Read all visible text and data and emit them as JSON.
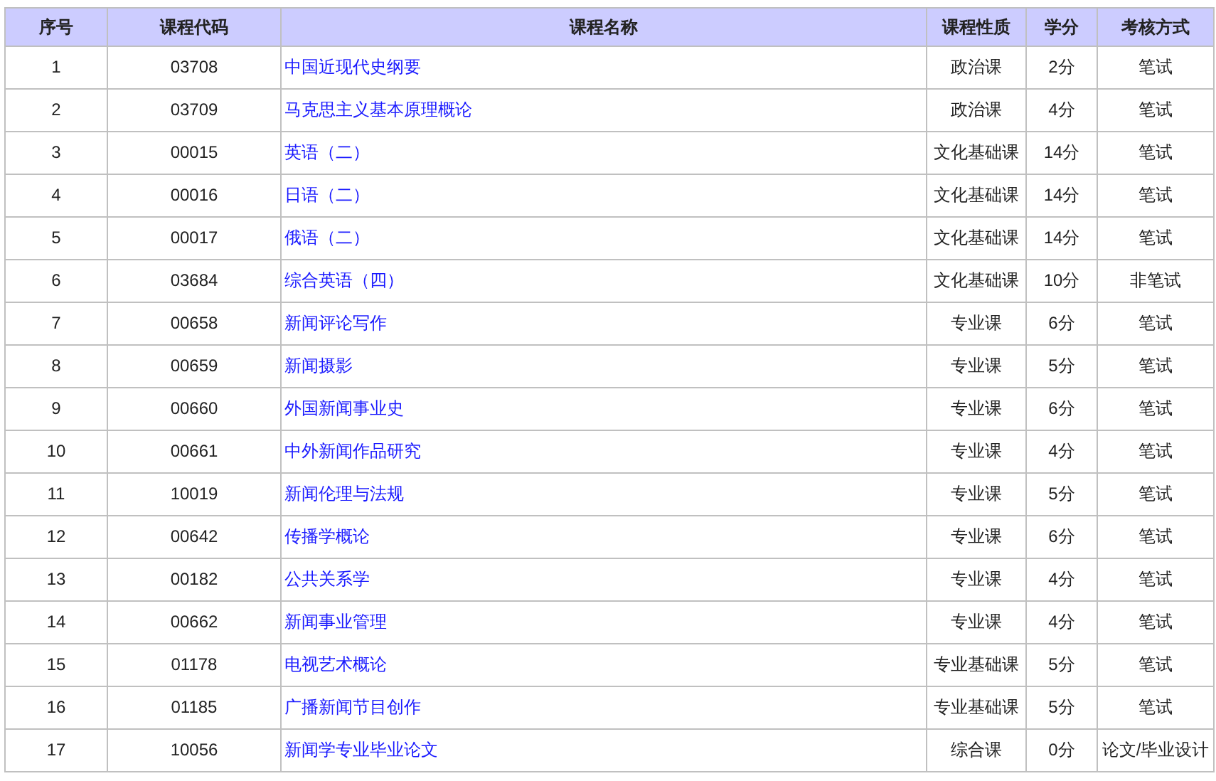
{
  "table": {
    "columns": [
      "序号",
      "课程代码",
      "课程名称",
      "课程性质",
      "学分",
      "考核方式"
    ],
    "rows": [
      [
        "1",
        "03708",
        "中国近现代史纲要",
        "政治课",
        "2分",
        "笔试"
      ],
      [
        "2",
        "03709",
        "马克思主义基本原理概论",
        "政治课",
        "4分",
        "笔试"
      ],
      [
        "3",
        "00015",
        "英语（二）",
        "文化基础课",
        "14分",
        "笔试"
      ],
      [
        "4",
        "00016",
        "日语（二）",
        "文化基础课",
        "14分",
        "笔试"
      ],
      [
        "5",
        "00017",
        "俄语（二）",
        "文化基础课",
        "14分",
        "笔试"
      ],
      [
        "6",
        "03684",
        "综合英语（四）",
        "文化基础课",
        "10分",
        "非笔试"
      ],
      [
        "7",
        "00658",
        "新闻评论写作",
        "专业课",
        "6分",
        "笔试"
      ],
      [
        "8",
        "00659",
        "新闻摄影",
        "专业课",
        "5分",
        "笔试"
      ],
      [
        "9",
        "00660",
        "外国新闻事业史",
        "专业课",
        "6分",
        "笔试"
      ],
      [
        "10",
        "00661",
        "中外新闻作品研究",
        "专业课",
        "4分",
        "笔试"
      ],
      [
        "11",
        "10019",
        "新闻伦理与法规",
        "专业课",
        "5分",
        "笔试"
      ],
      [
        "12",
        "00642",
        "传播学概论",
        "专业课",
        "6分",
        "笔试"
      ],
      [
        "13",
        "00182",
        "公共关系学",
        "专业课",
        "4分",
        "笔试"
      ],
      [
        "14",
        "00662",
        "新闻事业管理",
        "专业课",
        "4分",
        "笔试"
      ],
      [
        "15",
        "01178",
        "电视艺术概论",
        "专业基础课",
        "5分",
        "笔试"
      ],
      [
        "16",
        "01185",
        "广播新闻节目创作",
        "专业基础课",
        "5分",
        "笔试"
      ],
      [
        "17",
        "10056",
        "新闻学专业毕业论文",
        "综合课",
        "0分",
        "论文/毕业设计"
      ]
    ]
  }
}
